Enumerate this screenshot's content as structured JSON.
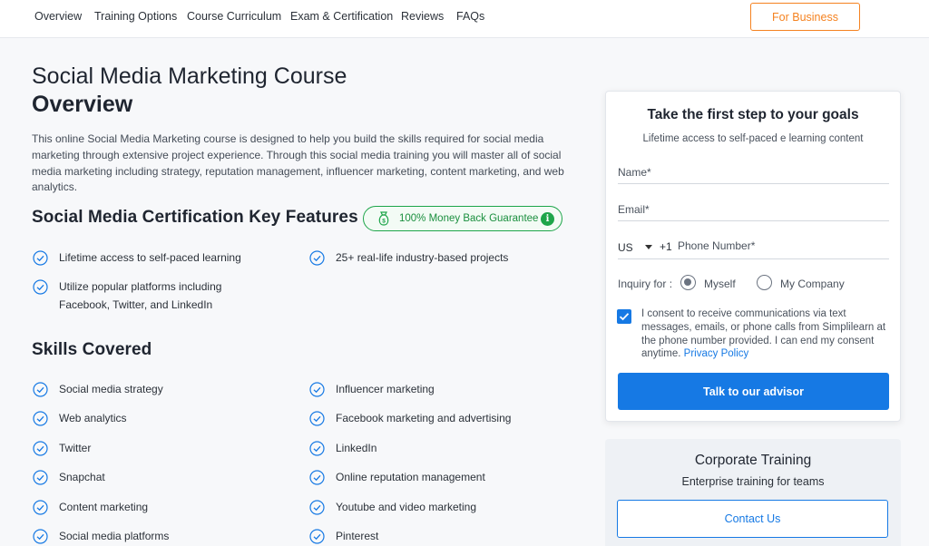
{
  "nav": {
    "items": [
      "Overview",
      "Training Options",
      "Course Curriculum",
      "Exam & Certification",
      "Reviews",
      "FAQs"
    ],
    "business_button": "For Business"
  },
  "overview": {
    "title_line1": "Social Media Marketing Course",
    "title_line2": "Overview",
    "description": "This online Social Media Marketing course is designed to help you build the skills required for social media marketing through extensive project experience. Through this social media training you will master all of social media marketing including strategy, reputation management, influencer marketing, content marketing, and web analytics."
  },
  "key_features": {
    "heading": "Social Media Certification Key Features",
    "badge": "100% Money Back Guarantee",
    "badge_info": "i",
    "items": [
      "Lifetime access to self-paced learning",
      "25+ real-life industry-based projects",
      "Utilize popular platforms including Facebook, Twitter, and LinkedIn"
    ]
  },
  "skills": {
    "heading": "Skills Covered",
    "items": [
      "Social media strategy",
      "Influencer marketing",
      "Web analytics",
      "Facebook marketing and advertising",
      "Twitter",
      "LinkedIn",
      "Snapchat",
      "Online reputation management",
      "Content marketing",
      "Youtube and video marketing",
      "Social media platforms",
      "Pinterest"
    ]
  },
  "form": {
    "title": "Take the first step to your goals",
    "subtitle": "Lifetime access to self-paced e learning content",
    "name_placeholder": "Name*",
    "email_placeholder": "Email*",
    "country_code": "US",
    "dial_code": "+1",
    "phone_placeholder": "Phone Number*",
    "inquiry_label": "Inquiry for :",
    "options": [
      "Myself",
      "My Company"
    ],
    "selected_option": "Myself",
    "consent_checked": true,
    "consent_text": "I consent to receive communications via text messages, emails, or phone calls from Simplilearn at the phone number provided. I can end my consent anytime.",
    "privacy_link": "Privacy Policy",
    "submit": "Talk to our advisor"
  },
  "corporate": {
    "title": "Corporate Training",
    "subtitle": "Enterprise training for teams",
    "button": "Contact Us"
  },
  "colors": {
    "accent_blue": "#1679e4",
    "business_orange": "#f58220",
    "guarantee_green": "#1ea54a"
  }
}
